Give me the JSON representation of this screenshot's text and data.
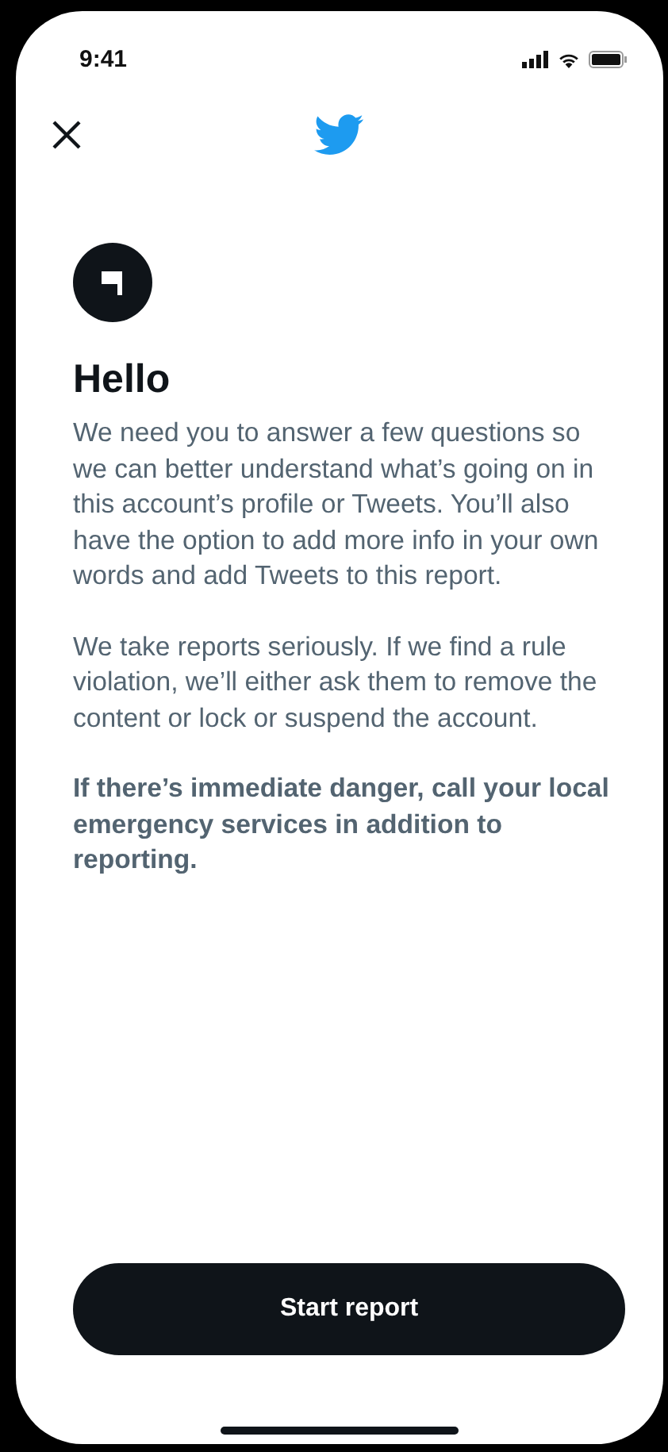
{
  "status_bar": {
    "time": "9:41"
  },
  "title": "Hello",
  "paragraphs": [
    {
      "text": "We need you to answer a few questions so we can better understand what’s going on in this account’s profile or Tweets. You’ll also have the option to add more info in your own words and add Tweets to this report.",
      "bold": false
    },
    {
      "text": "We take reports seriously. If we find a rule violation, we’ll either ask them to remove the content or lock or suspend the account.",
      "bold": false
    },
    {
      "text": "If there’s immediate danger, call your local emergency services in addition to reporting.",
      "bold": true
    }
  ],
  "button": "Start report"
}
